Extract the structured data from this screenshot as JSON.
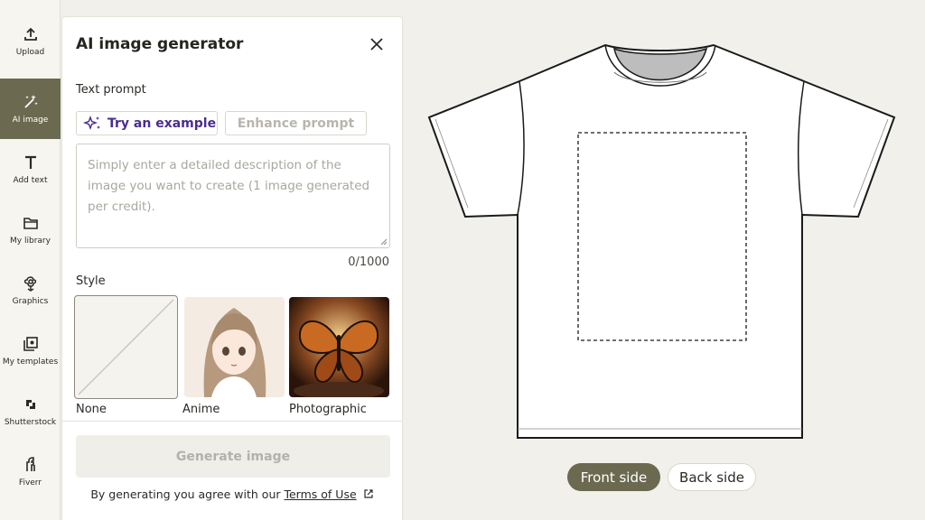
{
  "rail": {
    "items": [
      {
        "label": "Upload",
        "icon": "upload-icon"
      },
      {
        "label": "AI image",
        "icon": "magic-wand-icon",
        "active": true
      },
      {
        "label": "Add text",
        "icon": "text-icon"
      },
      {
        "label": "My library",
        "icon": "folder-icon"
      },
      {
        "label": "Graphics",
        "icon": "flower-icon"
      },
      {
        "label": "My templates",
        "icon": "templates-icon"
      },
      {
        "label": "Shutterstock",
        "icon": "shutterstock-icon"
      },
      {
        "label": "Fiverr",
        "icon": "fiverr-icon"
      }
    ]
  },
  "panel": {
    "title": "AI image generator",
    "text_prompt_label": "Text prompt",
    "try_example_label": "Try an example",
    "enhance_prompt_label": "Enhance prompt",
    "prompt_placeholder": "Simply enter a detailed description of the image you want to create (1 image generated per credit).",
    "prompt_value": "",
    "counter": "0/1000",
    "style_label": "Style",
    "styles": [
      {
        "name": "None",
        "selected": true
      },
      {
        "name": "Anime",
        "selected": false
      },
      {
        "name": "Photographic",
        "selected": false
      }
    ],
    "generate_label": "Generate image",
    "terms_prefix": "By generating you agree with our ",
    "terms_link": "Terms of Use"
  },
  "canvas": {
    "front_label": "Front side",
    "back_label": "Back side",
    "active_side": "front"
  },
  "colors": {
    "accent": "#6b6a50",
    "try_example": "#4a2d8f",
    "background": "#f1f0ea"
  }
}
